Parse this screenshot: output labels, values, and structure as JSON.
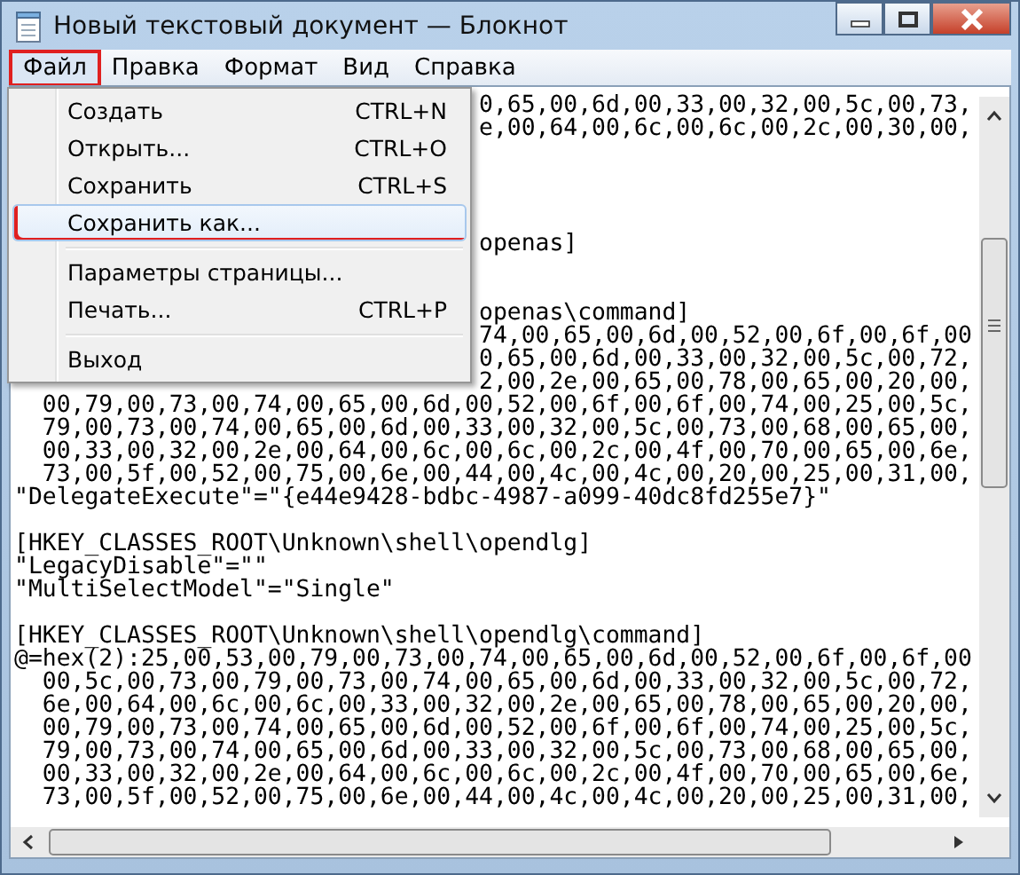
{
  "window": {
    "title": "Новый текстовый документ — Блокнот"
  },
  "menu_bar": [
    {
      "label": "Файл",
      "selected": true,
      "marked": true
    },
    {
      "label": "Правка",
      "selected": false,
      "marked": false
    },
    {
      "label": "Формат",
      "selected": false,
      "marked": false
    },
    {
      "label": "Вид",
      "selected": false,
      "marked": false
    },
    {
      "label": "Справка",
      "selected": false,
      "marked": false
    }
  ],
  "file_menu": [
    {
      "kind": "command",
      "label": "Создать",
      "shortcut": "CTRL+N",
      "selected": false,
      "marked": false
    },
    {
      "kind": "command",
      "label": "Открыть...",
      "shortcut": "CTRL+O",
      "selected": false,
      "marked": false
    },
    {
      "kind": "command",
      "label": "Сохранить",
      "shortcut": "CTRL+S",
      "selected": false,
      "marked": false
    },
    {
      "kind": "command",
      "label": "Сохранить как...",
      "selected": true,
      "marked": true
    },
    {
      "kind": "separator"
    },
    {
      "kind": "command",
      "label": "Параметры страницы...",
      "selected": false,
      "marked": false
    },
    {
      "kind": "command",
      "label": "Печать...",
      "shortcut": "CTRL+P",
      "selected": false,
      "marked": false
    },
    {
      "kind": "separator"
    },
    {
      "kind": "command",
      "label": "Выход",
      "selected": false,
      "marked": false
    }
  ],
  "editor_lines": [
    {
      "kind": "partial",
      "text": "0,65,00,6d,00,33,00,32,00,5c,00,73,"
    },
    {
      "kind": "partial",
      "text": "e,00,64,00,6c,00,6c,00,2c,00,30,00,"
    },
    {
      "kind": "blank"
    },
    {
      "kind": "blank"
    },
    {
      "kind": "blank"
    },
    {
      "kind": "blank"
    },
    {
      "kind": "partial",
      "text": "openas]"
    },
    {
      "kind": "blank"
    },
    {
      "kind": "blank"
    },
    {
      "kind": "partial",
      "text": "openas\\command]"
    },
    {
      "kind": "partial",
      "text": "74,00,65,00,6d,00,52,00,6f,00,6f,00"
    },
    {
      "kind": "partial",
      "text": "0,65,00,6d,00,33,00,32,00,5c,00,72,"
    },
    {
      "kind": "partial",
      "text": "2,00,2e,00,65,00,78,00,65,00,20,00,"
    },
    {
      "kind": "full",
      "text": "  00,79,00,73,00,74,00,65,00,6d,00,52,00,6f,00,6f,00,74,00,25,00,5c,"
    },
    {
      "kind": "full",
      "text": "  79,00,73,00,74,00,65,00,6d,00,33,00,32,00,5c,00,73,00,68,00,65,00,"
    },
    {
      "kind": "full",
      "text": "  00,33,00,32,00,2e,00,64,00,6c,00,6c,00,2c,00,4f,00,70,00,65,00,6e,"
    },
    {
      "kind": "full",
      "text": "  73,00,5f,00,52,00,75,00,6e,00,44,00,4c,00,4c,00,20,00,25,00,31,00,"
    },
    {
      "kind": "full",
      "text": "\"DelegateExecute\"=\"{e44e9428-bdbc-4987-a099-40dc8fd255e7}\""
    },
    {
      "kind": "blank"
    },
    {
      "kind": "full",
      "text": "[HKEY_CLASSES_ROOT\\Unknown\\shell\\opendlg]"
    },
    {
      "kind": "full",
      "text": "\"LegacyDisable\"=\"\""
    },
    {
      "kind": "full",
      "text": "\"MultiSelectModel\"=\"Single\""
    },
    {
      "kind": "blank"
    },
    {
      "kind": "full",
      "text": "[HKEY_CLASSES_ROOT\\Unknown\\shell\\opendlg\\command]"
    },
    {
      "kind": "full",
      "text": "@=hex(2):25,00,53,00,79,00,73,00,74,00,65,00,6d,00,52,00,6f,00,6f,00"
    },
    {
      "kind": "full",
      "text": "  00,5c,00,73,00,79,00,73,00,74,00,65,00,6d,00,33,00,32,00,5c,00,72,"
    },
    {
      "kind": "full",
      "text": "  6e,00,64,00,6c,00,6c,00,33,00,32,00,2e,00,65,00,78,00,65,00,20,00,"
    },
    {
      "kind": "full",
      "text": "  00,79,00,73,00,74,00,65,00,6d,00,52,00,6f,00,6f,00,74,00,25,00,5c,"
    },
    {
      "kind": "full",
      "text": "  79,00,73,00,74,00,65,00,6d,00,33,00,32,00,5c,00,73,00,68,00,65,00,"
    },
    {
      "kind": "full",
      "text": "  00,33,00,32,00,2e,00,64,00,6c,00,6c,00,2c,00,4f,00,70,00,65,00,6e,"
    },
    {
      "kind": "full",
      "text": "  73,00,5f,00,52,00,75,00,6e,00,44,00,4c,00,4c,00,20,00,25,00,31,00,"
    }
  ]
}
